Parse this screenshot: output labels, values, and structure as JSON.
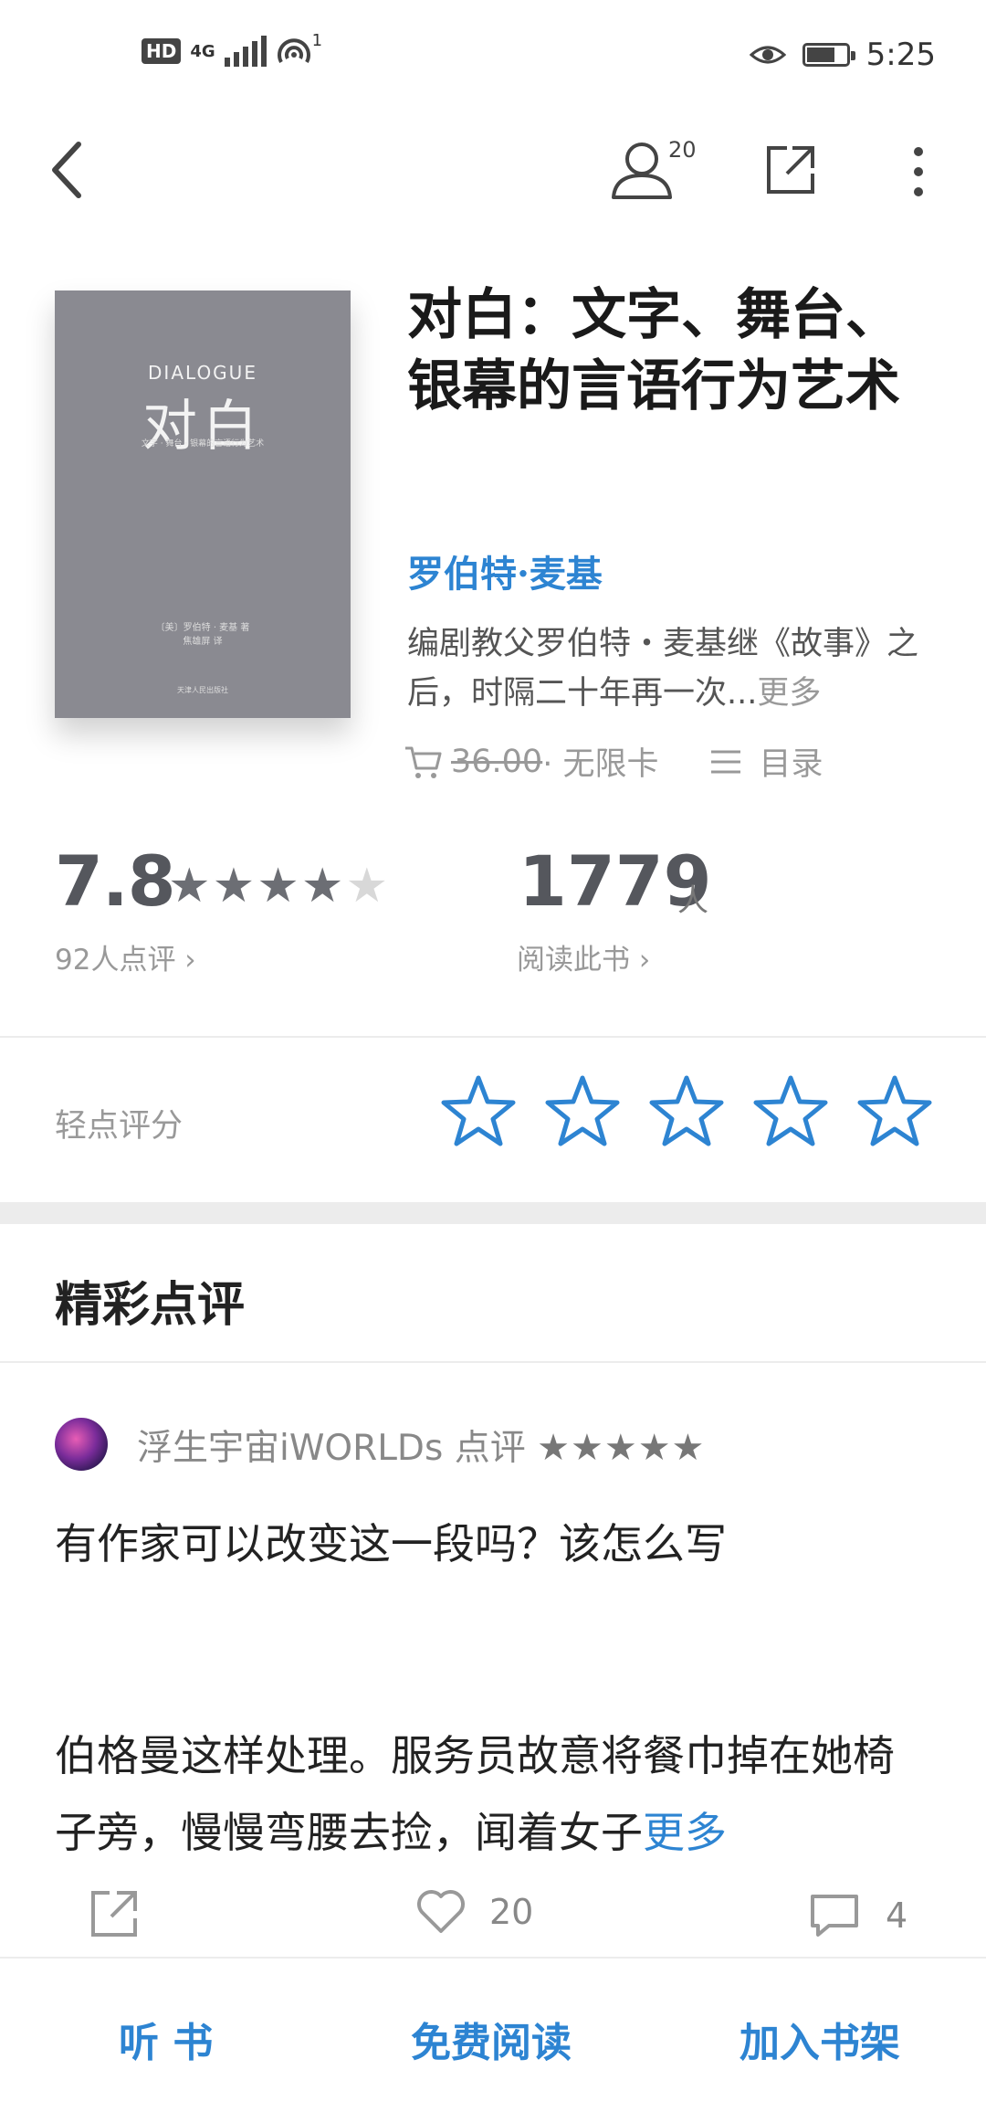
{
  "status_bar": {
    "hd": "HD",
    "network": "4G",
    "hotspot_count": "1",
    "time": "5:25"
  },
  "toolbar": {
    "back_icon": "chevron-left-icon",
    "readers_badge": "20",
    "share_icon": "share-external-icon",
    "more_icon": "more-vertical-icon"
  },
  "book": {
    "cover": {
      "english_title": "DIALOGUE",
      "chinese_title": "对白",
      "subtitle": "文字 · 舞台 · 银幕的言语行为艺术",
      "author_line": "〔美〕罗伯特 · 麦基 著",
      "translator_line": "焦雄屏 译",
      "publisher": "天津人民出版社"
    },
    "title": "对白：文字、舞台、银幕的言语行为艺术",
    "author": "罗伯特·麦基",
    "description": "编剧教父罗伯特・麦基继《故事》之后，时隔二十年再一次...",
    "description_more": "更多",
    "price": "36.00",
    "price_suffix": " · 无限卡",
    "toc_label": "目录"
  },
  "rating": {
    "score": "7.8",
    "stars_filled": 4,
    "stars_total": 5,
    "review_count": "92人点评",
    "readers": "1779",
    "readers_unit": "人",
    "readers_label": "阅读此书"
  },
  "tap_rate": {
    "label": "轻点评分"
  },
  "featured": {
    "title": "精彩点评",
    "review": {
      "reviewer": "浮生宇宙iWORLDs",
      "action": "点评",
      "stars": "★★★★★",
      "line1": "有作家可以改变这一段吗？该怎么写",
      "body": "伯格曼这样处理。服务员故意将餐巾掉在她椅子旁，慢慢弯腰去捡，闻着女子",
      "more": "更多",
      "likes": "20",
      "comments": "4"
    }
  },
  "bottom_bar": {
    "listen": "听 书",
    "free_read": "免费阅读",
    "add_shelf": "加入书架"
  },
  "colors": {
    "accent": "#2d84d2",
    "muted": "#999999",
    "cover": "#8a8a91"
  }
}
